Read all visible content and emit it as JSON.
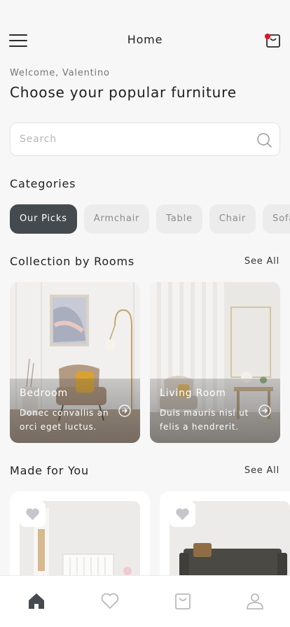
{
  "header": {
    "title": "Home",
    "menu_icon": "hamburger-menu-icon",
    "cart_icon": "shopping-bag-icon",
    "cart_badge_color": "#d9152c"
  },
  "welcome_text": "Welcome, Valentino",
  "headline": "Choose your popular furniture",
  "search": {
    "placeholder": "Search",
    "icon": "search-icon"
  },
  "categories": {
    "title": "Categories",
    "items": [
      {
        "label": "Our Picks",
        "active": true
      },
      {
        "label": "Armchair",
        "active": false
      },
      {
        "label": "Table",
        "active": false
      },
      {
        "label": "Chair",
        "active": false
      },
      {
        "label": "Sofa",
        "active": false
      }
    ]
  },
  "collection": {
    "title": "Collection by Rooms",
    "see_all": "See All",
    "rooms": [
      {
        "name": "Bedroom",
        "description": "Donec convallis an orci eget luctus."
      },
      {
        "name": "Living Room",
        "description": "Duis mauris nisl ut felis a hendrerit."
      }
    ]
  },
  "made_for_you": {
    "title": "Made for You",
    "see_all": "See All"
  },
  "bottom_nav": {
    "items": [
      "home-icon",
      "heart-icon",
      "shopping-bag-icon",
      "user-icon"
    ],
    "active_index": 0
  },
  "colors": {
    "accent_dark": "#454a4f",
    "background": "#f7f7f7",
    "chip_inactive": "#ececec"
  }
}
